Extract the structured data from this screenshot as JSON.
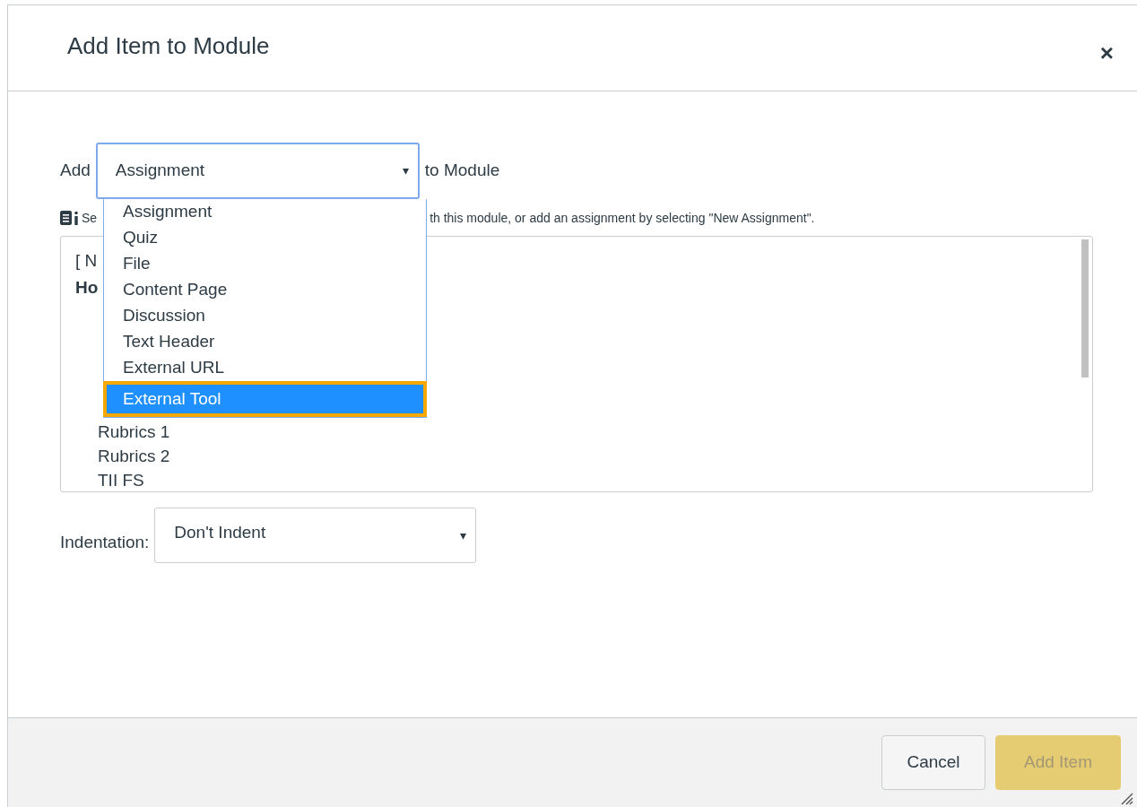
{
  "dialog": {
    "title": "Add Item to Module",
    "close": "×"
  },
  "add_row": {
    "prefix": "Add",
    "select_value": "Assignment",
    "caret": "▾",
    "suffix": "to Module",
    "options": [
      {
        "label": "Assignment",
        "selected": false
      },
      {
        "label": "Quiz",
        "selected": false
      },
      {
        "label": "File",
        "selected": false
      },
      {
        "label": "Content Page",
        "selected": false
      },
      {
        "label": "Discussion",
        "selected": false
      },
      {
        "label": "Text Header",
        "selected": false
      },
      {
        "label": "External URL",
        "selected": false
      },
      {
        "label": "External Tool",
        "selected": true
      }
    ]
  },
  "hint": {
    "left": "Se",
    "right": "th this module, or add an assignment by selecting \"New Assignment\"."
  },
  "list_items": [
    {
      "label": "[ N"
    },
    {
      "label": "Ho",
      "children": [
        {
          "label": "Rubrics 1"
        },
        {
          "label": "Rubrics 2"
        },
        {
          "label": "TII FS"
        }
      ]
    }
  ],
  "indentation": {
    "label": "Indentation:",
    "value": "Don't Indent",
    "caret": "▾"
  },
  "footer": {
    "buttons": [
      {
        "label": "Cancel",
        "kind": "secondary",
        "disabled": false
      },
      {
        "label": "Add Item",
        "kind": "primary",
        "disabled": true
      }
    ]
  }
}
